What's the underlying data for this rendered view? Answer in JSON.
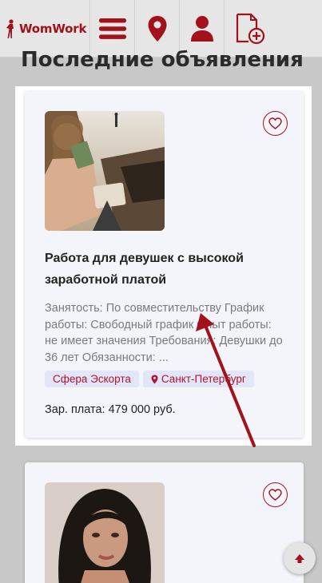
{
  "header": {
    "logo_text": "WomWork",
    "icons": [
      "hamburger-menu-icon",
      "location-pin-icon",
      "user-icon",
      "add-document-icon"
    ]
  },
  "page": {
    "title": "Последние объявления"
  },
  "listings": [
    {
      "title": "Работа для девушек с высокой заработной платой",
      "description": "Занятость: По совместительству График работы: Свободный график Опыт работы: не имеет значения Требования: Девушки до 36 лет Обязанности: ...",
      "tags": [
        {
          "label": "Сфера Эскорта",
          "icon": ""
        },
        {
          "label": "Санкт-Петербург",
          "icon": "location-pin-icon"
        }
      ],
      "salary": "Зар. плата: 479 000 руб."
    },
    {
      "title": "",
      "description": "",
      "tags": [],
      "salary": ""
    }
  ],
  "colors": {
    "brand": "#a3111b",
    "card_bg": "#f4f5fb",
    "tag_bg": "#e3e5f8",
    "annotation_arrow": "#a3111b"
  }
}
